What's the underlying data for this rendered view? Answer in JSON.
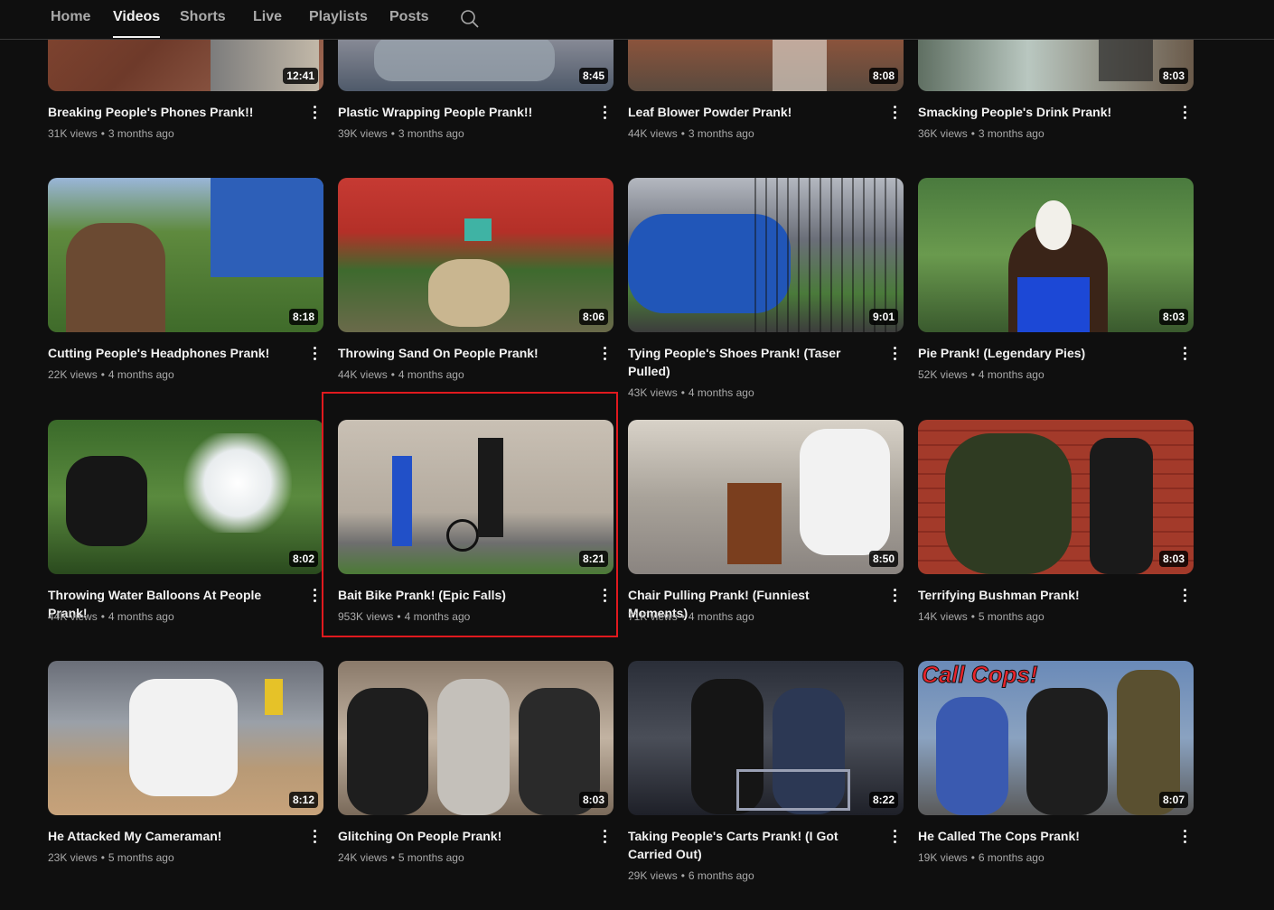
{
  "nav": {
    "tabs": [
      "Home",
      "Videos",
      "Shorts",
      "Live",
      "Playlists",
      "Posts"
    ],
    "active_tab": "Videos",
    "search_icon": "search-icon"
  },
  "videos": [
    {
      "title": "Breaking People's Phones Prank!!",
      "views": "31K views",
      "age": "3 months ago",
      "duration": "12:41"
    },
    {
      "title": "Plastic Wrapping People Prank!!",
      "views": "39K views",
      "age": "3 months ago",
      "duration": "8:45"
    },
    {
      "title": "Leaf Blower Powder Prank!",
      "views": "44K views",
      "age": "3 months ago",
      "duration": "8:08"
    },
    {
      "title": "Smacking People's Drink Prank!",
      "views": "36K views",
      "age": "3 months ago",
      "duration": "8:03"
    },
    {
      "title": "Cutting People's Headphones Prank!",
      "views": "22K views",
      "age": "4 months ago",
      "duration": "8:18"
    },
    {
      "title": "Throwing Sand On People Prank!",
      "views": "44K views",
      "age": "4 months ago",
      "duration": "8:06"
    },
    {
      "title": "Tying People's Shoes Prank! (Taser Pulled)",
      "views": "43K views",
      "age": "4 months ago",
      "duration": "9:01"
    },
    {
      "title": "Pie Prank! (Legendary Pies)",
      "views": "52K views",
      "age": "4 months ago",
      "duration": "8:03"
    },
    {
      "title": "Throwing Water Balloons At People Prank!",
      "views": "44K views",
      "age": "4 months ago",
      "duration": "8:02"
    },
    {
      "title": "Bait Bike Prank! (Epic Falls)",
      "views": "953K views",
      "age": "4 months ago",
      "duration": "8:21"
    },
    {
      "title": "Chair Pulling Prank! (Funniest Moments)",
      "views": "71K views",
      "age": "4 months ago",
      "duration": "8:50"
    },
    {
      "title": "Terrifying Bushman Prank!",
      "views": "14K views",
      "age": "5 months ago",
      "duration": "8:03"
    },
    {
      "title": "He Attacked My Cameraman!",
      "views": "23K views",
      "age": "5 months ago",
      "duration": "8:12"
    },
    {
      "title": "Glitching On People Prank!",
      "views": "24K views",
      "age": "5 months ago",
      "duration": "8:03"
    },
    {
      "title": "Taking People's Carts Prank! (I Got Carried Out)",
      "views": "29K views",
      "age": "6 months ago",
      "duration": "8:22"
    },
    {
      "title": "He Called The Cops Prank!",
      "views": "19K views",
      "age": "6 months ago",
      "duration": "8:07"
    }
  ],
  "thumb_text": {
    "call_cops": "Call Cops!"
  },
  "highlighted_video": "Bait Bike Prank! (Epic Falls)",
  "colors": {
    "background": "#0f0f0f",
    "text": "#f1f1f1",
    "secondary_text": "#aaaaaa",
    "highlight_border": "#e0191e"
  }
}
